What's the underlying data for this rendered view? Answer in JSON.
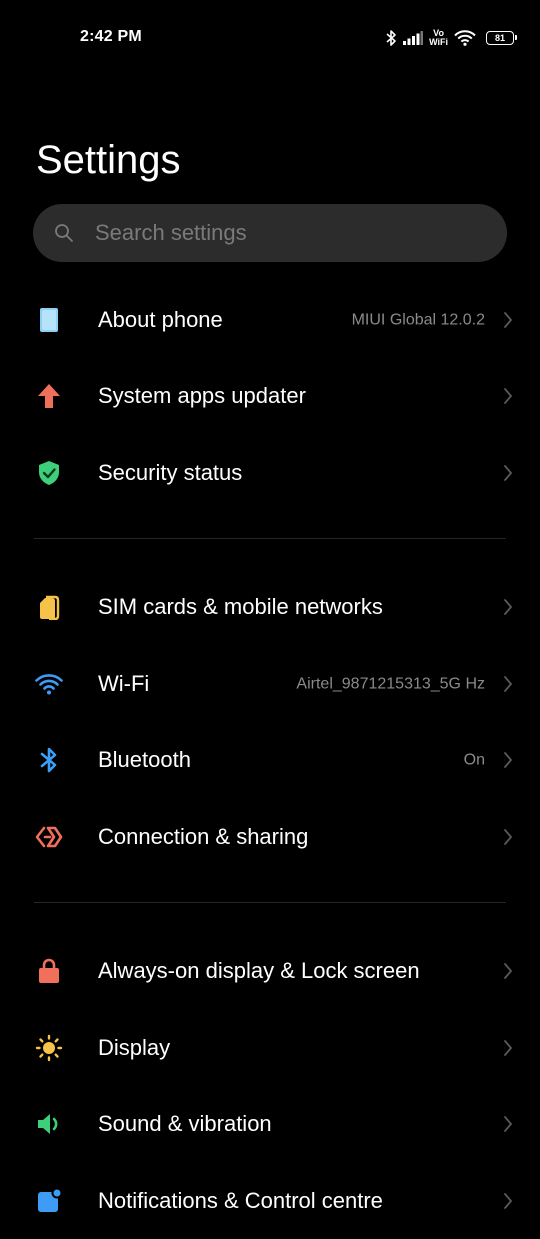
{
  "status_bar": {
    "time": "2:42 PM",
    "vowifi_top": "Vo",
    "vowifi_bottom": "WiFi",
    "battery": "81"
  },
  "page": {
    "title": "Settings"
  },
  "search": {
    "placeholder": "Search settings"
  },
  "items": [
    {
      "label": "About phone",
      "value": "MIUI Global 12.0.2",
      "icon": "phone-info-icon",
      "color": "#8fd0f5"
    },
    {
      "label": "System apps updater",
      "value": "",
      "icon": "arrow-up-icon",
      "color": "#f0705c"
    },
    {
      "label": "Security status",
      "value": "",
      "icon": "shield-check-icon",
      "color": "#3ecf7a"
    },
    {
      "label": "SIM cards & mobile networks",
      "value": "",
      "icon": "sim-card-icon",
      "color": "#f5c24a"
    },
    {
      "label": "Wi-Fi",
      "value": "Airtel_9871215313_5G Hz",
      "icon": "wifi-icon",
      "color": "#3d9cf5"
    },
    {
      "label": "Bluetooth",
      "value": "On",
      "icon": "bluetooth-icon",
      "color": "#3d9cf5"
    },
    {
      "label": "Connection & sharing",
      "value": "",
      "icon": "connection-sharing-icon",
      "color": "#f0705c"
    },
    {
      "label": "Always-on display & Lock screen",
      "value": "",
      "icon": "lock-icon",
      "color": "#f0705c"
    },
    {
      "label": "Display",
      "value": "",
      "icon": "sun-icon",
      "color": "#f5c24a"
    },
    {
      "label": "Sound & vibration",
      "value": "",
      "icon": "speaker-icon",
      "color": "#3ecf7a"
    },
    {
      "label": "Notifications & Control centre",
      "value": "",
      "icon": "notifications-icon",
      "color": "#3d9cf5"
    }
  ]
}
